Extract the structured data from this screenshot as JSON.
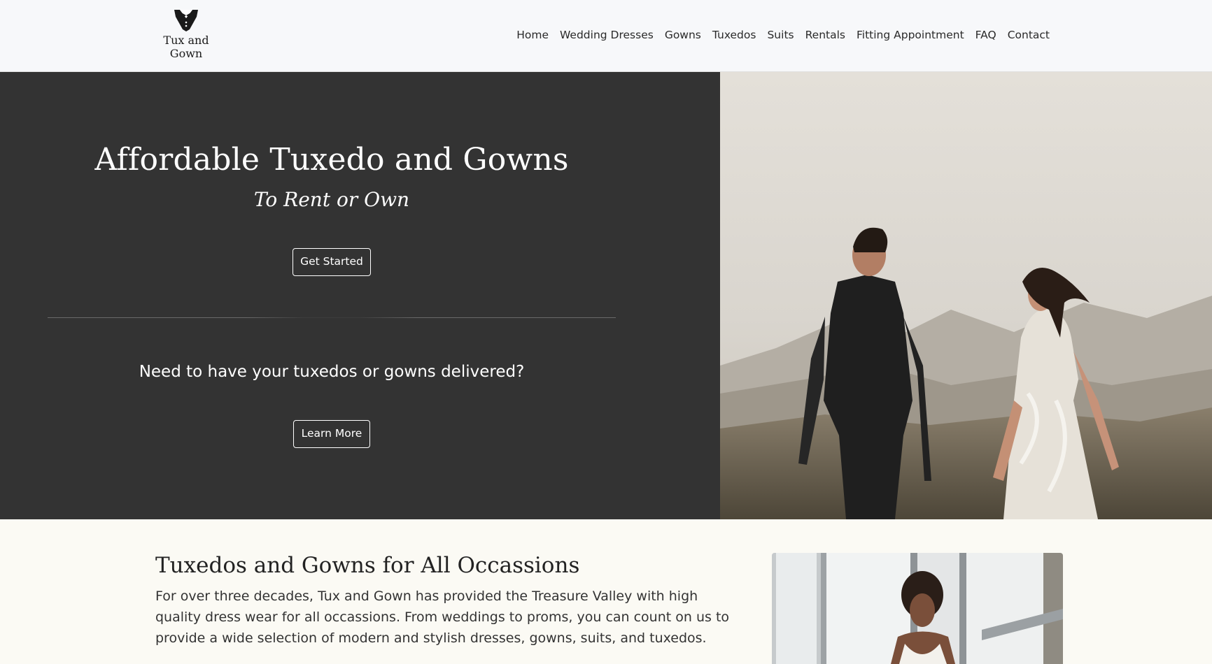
{
  "brand": {
    "name_line1": "Tux and",
    "name_line2": "Gown",
    "logo_icon": "tuxedo-bowtie-icon"
  },
  "nav": {
    "items": [
      {
        "label": "Home"
      },
      {
        "label": "Wedding Dresses"
      },
      {
        "label": "Gowns"
      },
      {
        "label": "Tuxedos"
      },
      {
        "label": "Suits"
      },
      {
        "label": "Rentals"
      },
      {
        "label": "Fitting Appointment"
      },
      {
        "label": "FAQ"
      },
      {
        "label": "Contact"
      }
    ]
  },
  "hero": {
    "title": "Affordable Tuxedo and Gowns",
    "subtitle": "To Rent or Own",
    "cta_label": "Get Started",
    "delivery_question": "Need to have your tuxedos or gowns delivered?",
    "learn_more_label": "Learn More"
  },
  "about": {
    "title": "Tuxedos and Gowns for All Occassions",
    "body": "For over three decades, Tux and Gown has provided the Treasure Valley with high quality dress wear for all occassions. From weddings to proms, you can count on us to provide a wide selection of modern and stylish dresses, gowns, suits, and tuxedos."
  },
  "colors": {
    "hero_bg": "#333333",
    "header_bg": "#f7f8fa",
    "section_bg": "#fbfaf4"
  }
}
